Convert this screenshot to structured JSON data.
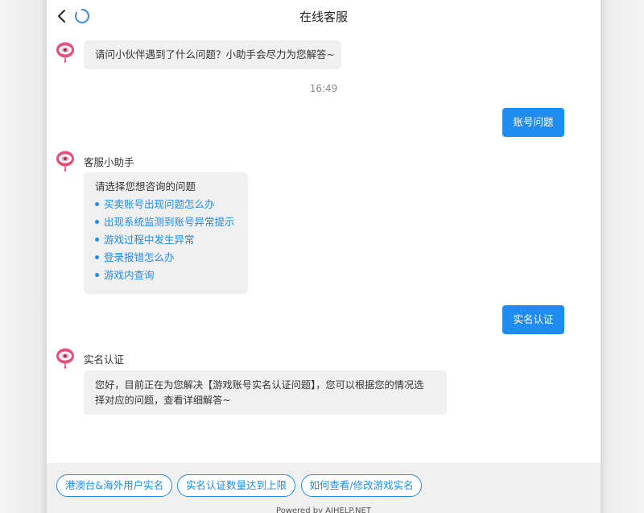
{
  "header": {
    "title": "在线客服"
  },
  "messages": {
    "greeting": "请问小伙伴遇到了什么问题？小助手会尽力为您解答~",
    "time": "16:49",
    "user_msg_1": "账号问题",
    "assistant_name": "客服小助手",
    "menu_title": "请选择您想咨询的问题",
    "menu_options": [
      "买卖账号出现问题怎么办",
      "出现系统监测到账号异常提示",
      "游戏过程中发生异常",
      "登录报错怎么办",
      "游戏内查询"
    ],
    "user_msg_2": "实名认证",
    "topic_name": "实名认证",
    "topic_reply_line1": "您好，目前正在为您解决【游戏账号实名认证问题】，您可以根据您的情况选",
    "topic_reply_line2": "择对应的问题，查看详细解答~"
  },
  "footer": {
    "chips": [
      "港澳台&海外用户实名",
      "实名认证数量达到上限",
      "如何查看/修改游戏实名"
    ],
    "powered_by": "Powered by AIHELP.NET"
  },
  "colors": {
    "accent": "#1e8cf0",
    "bubble": "#f0f0f0",
    "avatar": "#e8507a"
  },
  "icons": {
    "back": "chevron-left-icon",
    "loading": "spinner-icon",
    "avatar": "robot-avatar-icon"
  }
}
